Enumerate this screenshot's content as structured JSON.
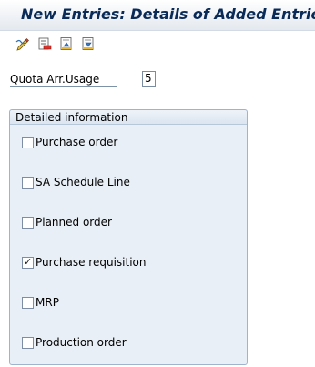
{
  "title": "New Entries: Details of Added Entries",
  "toolbar": {
    "buttons": [
      {
        "icon": "edit-pen-icon"
      },
      {
        "icon": "delete-row-icon"
      },
      {
        "icon": "previous-entry-icon"
      },
      {
        "icon": "next-entry-icon"
      }
    ]
  },
  "quota_field": {
    "label": "Quota Arr.Usage",
    "value": "5"
  },
  "detailed_info": {
    "title": "Detailed information",
    "options": [
      {
        "label": "Purchase order",
        "checked": false,
        "mark": ""
      },
      {
        "label": "SA Schedule Line",
        "checked": false,
        "mark": ""
      },
      {
        "label": "Planned order",
        "checked": false,
        "mark": ""
      },
      {
        "label": "Purchase requisition",
        "checked": true,
        "mark": "✓"
      },
      {
        "label": "MRP",
        "checked": false,
        "mark": ""
      },
      {
        "label": "Production order",
        "checked": false,
        "mark": ""
      }
    ]
  },
  "colors": {
    "title_text": "#0a2b58",
    "group_background": "#e9eff6",
    "group_border": "#9fb4cc"
  }
}
